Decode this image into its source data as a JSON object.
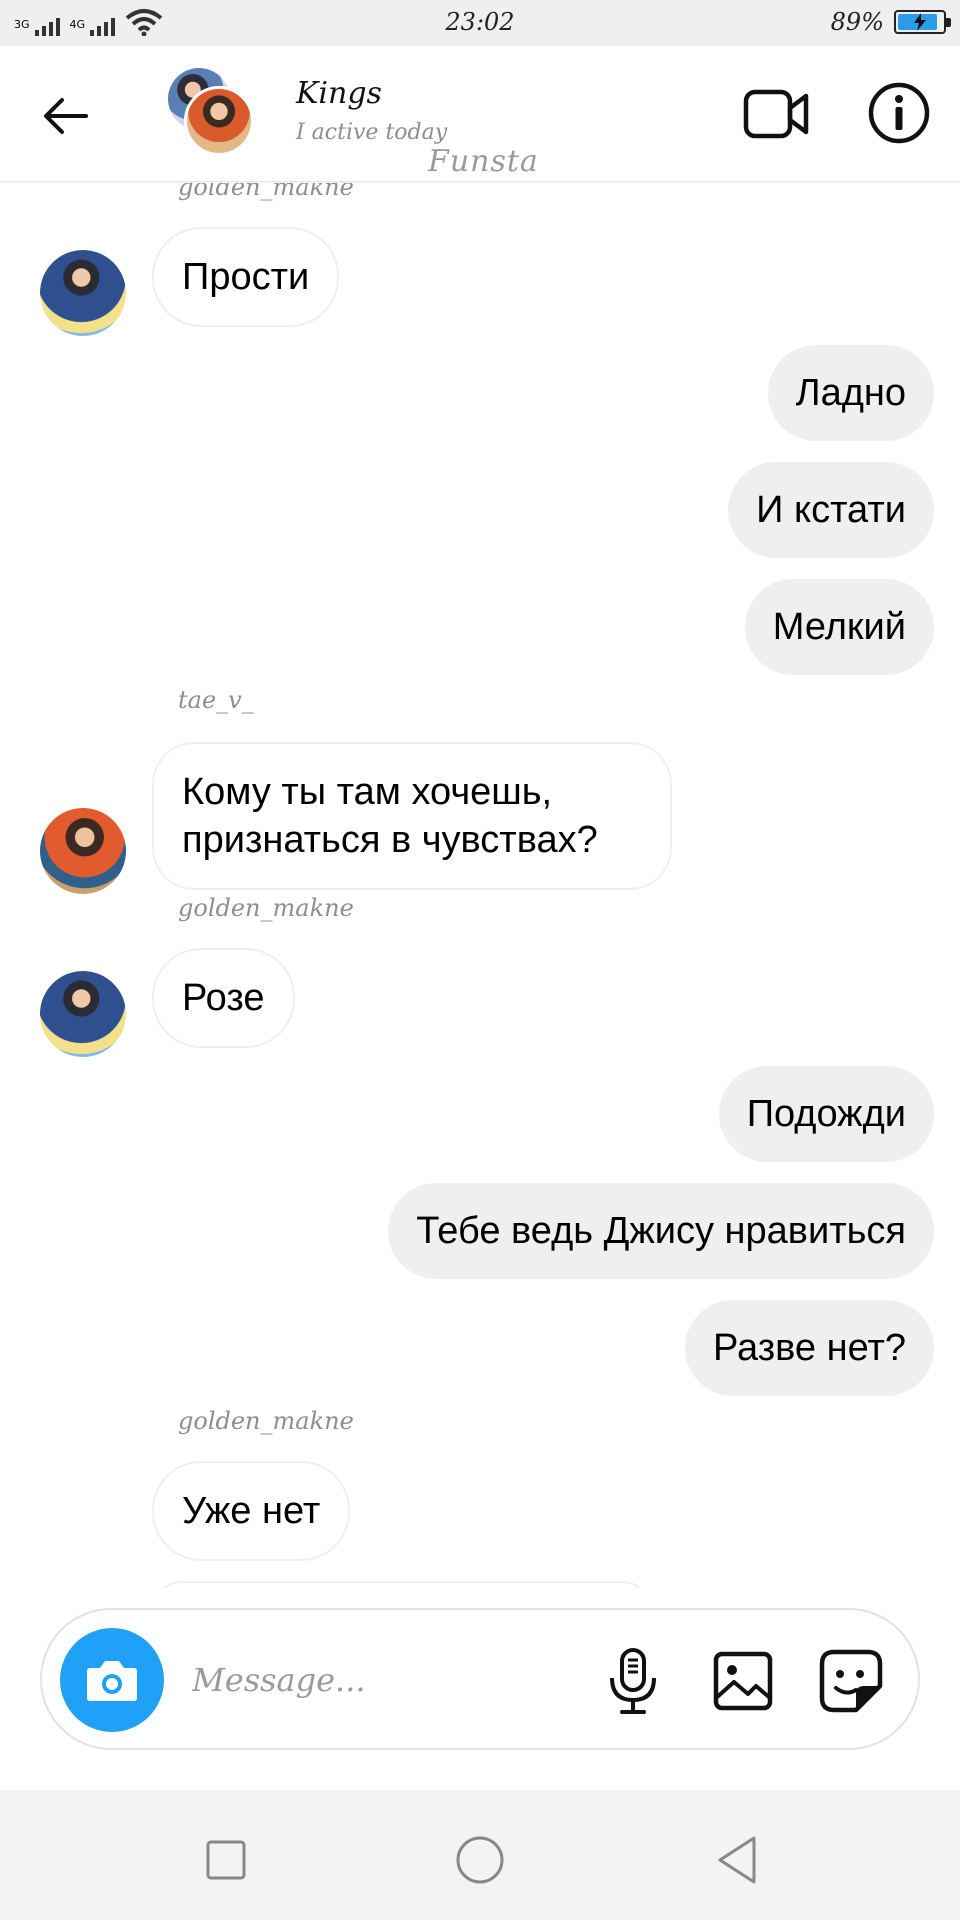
{
  "status_bar": {
    "network_1": "3G",
    "network_2": "4G",
    "time": "23:02",
    "battery_percent": "89%",
    "battery_level": 0.89,
    "battery_color": "#2a9de9"
  },
  "header": {
    "title": "Kings",
    "subtitle": "I active today",
    "watermark": "Funsta"
  },
  "messages": [
    {
      "direction": "in",
      "sender": "golden_makne",
      "text": "Прости"
    },
    {
      "direction": "out",
      "text": "Ладно"
    },
    {
      "direction": "out",
      "text": "И кстати"
    },
    {
      "direction": "out",
      "text": "Мелкий"
    },
    {
      "direction": "in",
      "sender": "tae_v_",
      "text": "Кому ты там хочешь, признаться в чувствах?"
    },
    {
      "direction": "in",
      "sender": "golden_makne",
      "text": "Розе"
    },
    {
      "direction": "out",
      "text": "Подожди"
    },
    {
      "direction": "out",
      "text": "Тебе ведь Джису нравиться"
    },
    {
      "direction": "out",
      "text": "Разве нет?"
    },
    {
      "direction": "in",
      "sender": "golden_makne",
      "text": "Уже нет"
    }
  ],
  "composer": {
    "placeholder": "Message...",
    "camera_color": "#1ea1f7"
  },
  "icons": {
    "back": "arrow-left-icon",
    "video": "video-camera-icon",
    "info": "info-icon",
    "camera": "camera-icon",
    "mic": "microphone-icon",
    "gallery": "image-icon",
    "sticker": "sticker-icon",
    "recents": "square-icon",
    "home": "circle-icon",
    "back_nav": "triangle-back-icon"
  }
}
